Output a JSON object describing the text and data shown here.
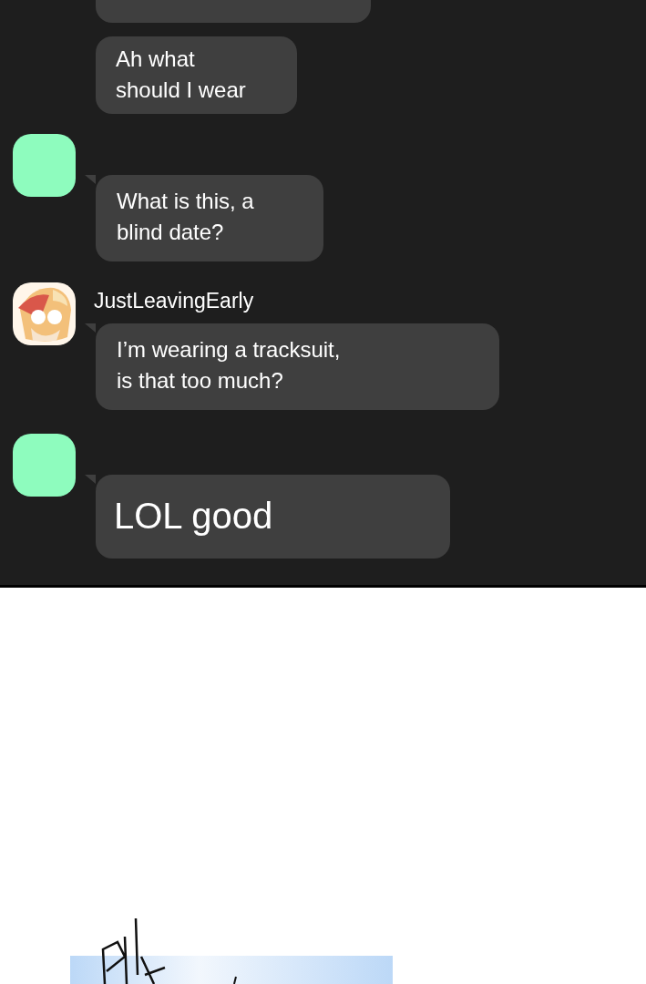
{
  "chat": {
    "messages": [
      {
        "kind": "cut"
      },
      {
        "kind": "continuation",
        "text": "Ah what\nshould I wear"
      },
      {
        "kind": "first",
        "avatar": {
          "kind": "blank"
        },
        "text": "What is this, a\nblind date?"
      },
      {
        "kind": "first",
        "sender": "JustLeavingEarly",
        "text": "I’m wearing a tracksuit,\nis that too much?"
      },
      {
        "kind": "first",
        "avatar": {
          "kind": "blank"
        },
        "text": "LOL good",
        "large": true
      }
    ]
  }
}
